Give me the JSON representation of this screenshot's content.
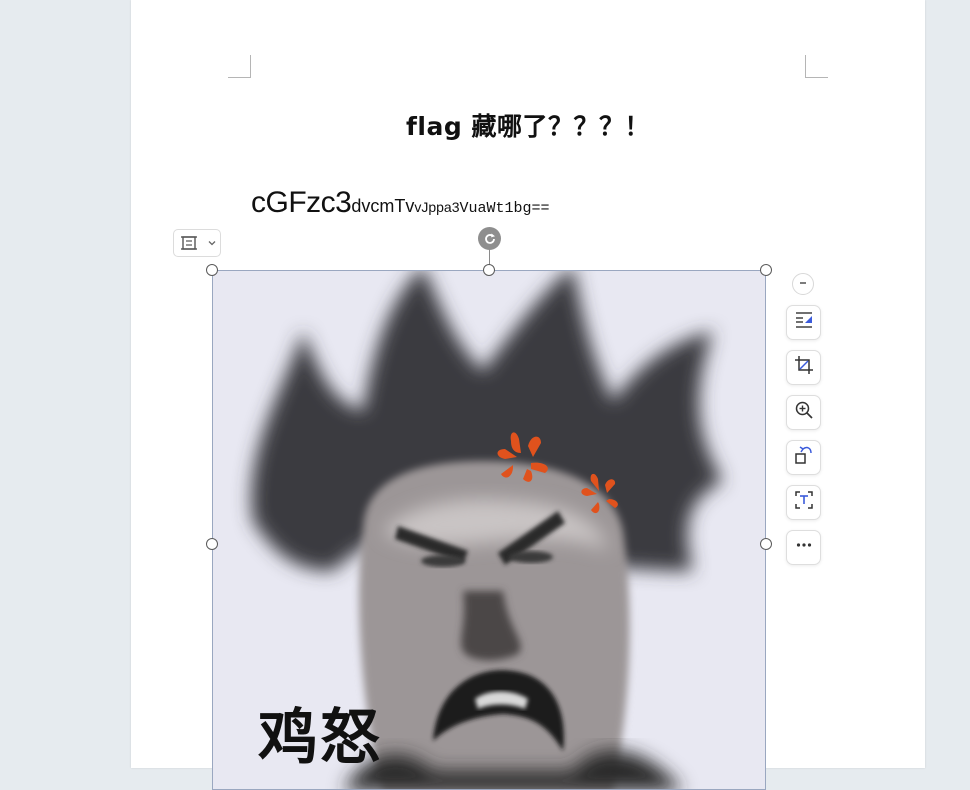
{
  "document": {
    "title": "flag 藏哪了？？？！",
    "code_text": {
      "part1": "cGFzc3",
      "part2": "dvcmTv",
      "part3": "vJppa3",
      "part4": "VuaWt1bg=="
    }
  },
  "image": {
    "caption": "鸡怒"
  },
  "icons": {
    "layout": "layout-options-icon",
    "chevron": "chevron-down-icon",
    "rotate": "rotate-icon",
    "collapse": "minus-icon",
    "text_wrap": "text-wrap-icon",
    "crop": "crop-icon",
    "zoom": "zoom-in-icon",
    "replace": "replace-image-icon",
    "ocr": "extract-text-icon",
    "more": "more-icon"
  },
  "colors": {
    "accent": "#3b5bdb",
    "anger_mark": "#e0521d"
  }
}
